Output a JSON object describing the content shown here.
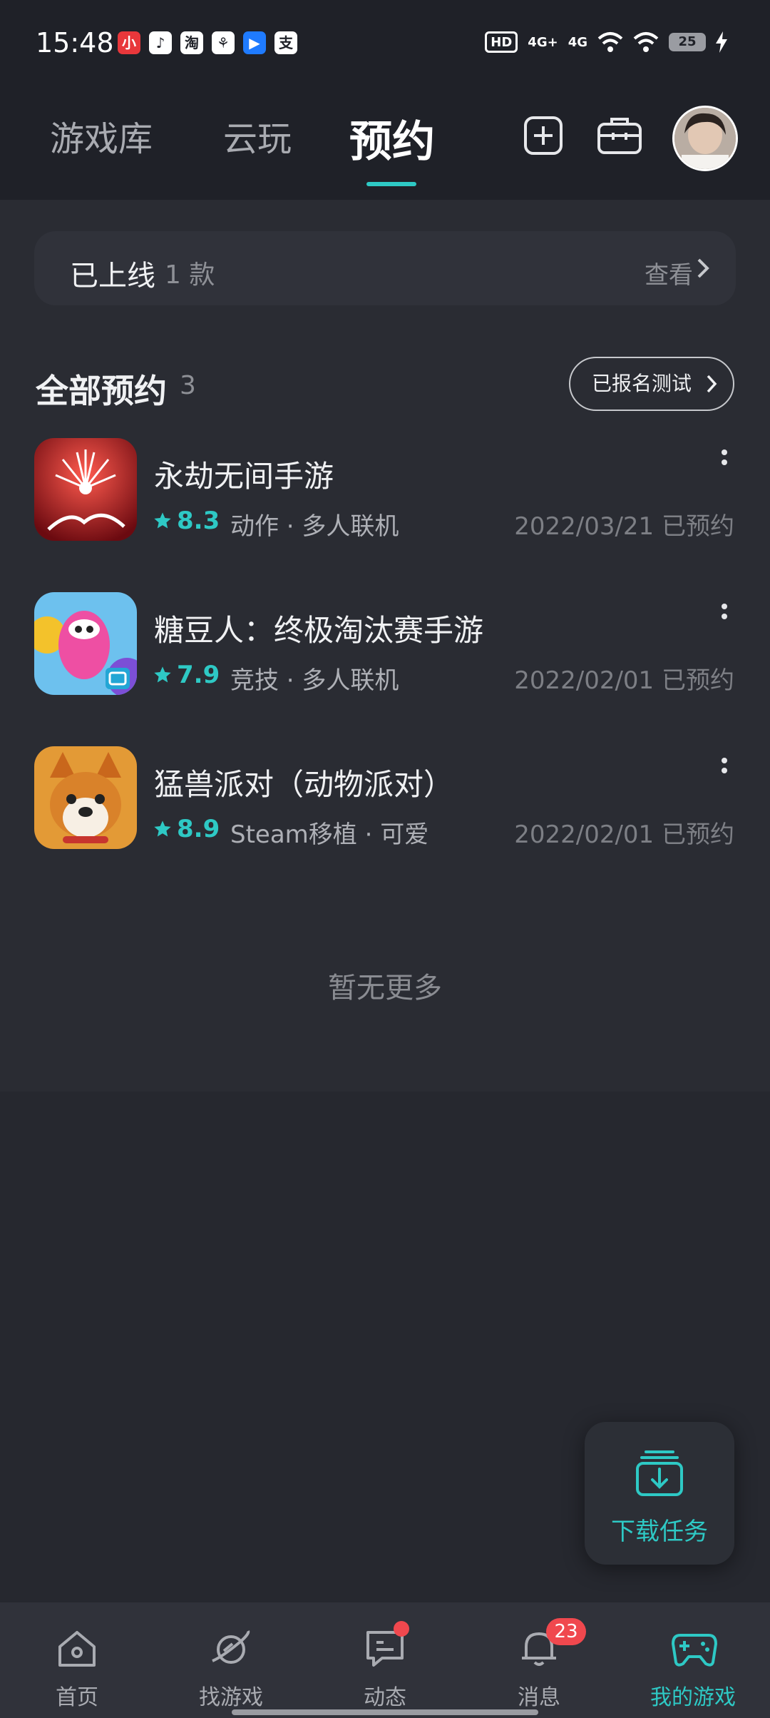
{
  "status_bar": {
    "time": "15:48",
    "apps": [
      "小",
      "♪",
      "淘",
      "⚘",
      "▶",
      "支"
    ],
    "indicators": [
      "HD",
      "4G+",
      "4G"
    ],
    "battery": "25"
  },
  "tabs": [
    {
      "label": "游戏库"
    },
    {
      "label": "云玩"
    },
    {
      "label": "预约",
      "active": true
    }
  ],
  "online": {
    "title": "已上线",
    "count": "1 款",
    "view": "查看"
  },
  "section": {
    "title": "全部预约",
    "count": "3",
    "test_button": "已报名测试"
  },
  "games": [
    {
      "title": "永劫无间手游",
      "score": "8.3",
      "tags": "动作 · 多人联机",
      "date": "2022/03/21 已预约"
    },
    {
      "title": "糖豆人：终极淘汰赛手游",
      "score": "7.9",
      "tags": "竞技 · 多人联机",
      "date": "2022/02/01 已预约"
    },
    {
      "title": "猛兽派对（动物派对）",
      "score": "8.9",
      "tags": "Steam移植 · 可爱",
      "date": "2022/02/01 已预约"
    }
  ],
  "no_more": "暂无更多",
  "fab": {
    "label": "下载任务"
  },
  "bottom_nav": [
    {
      "label": "首页",
      "icon": "home-icon"
    },
    {
      "label": "找游戏",
      "icon": "planet-icon"
    },
    {
      "label": "动态",
      "icon": "chat-icon"
    },
    {
      "label": "消息",
      "icon": "bell-icon",
      "badge": "23"
    },
    {
      "label": "我的游戏",
      "icon": "gamepad-icon",
      "active": true
    }
  ],
  "colors": {
    "accent": "#2ec9c5",
    "background": "#26282f",
    "badge": "#f0484e"
  }
}
